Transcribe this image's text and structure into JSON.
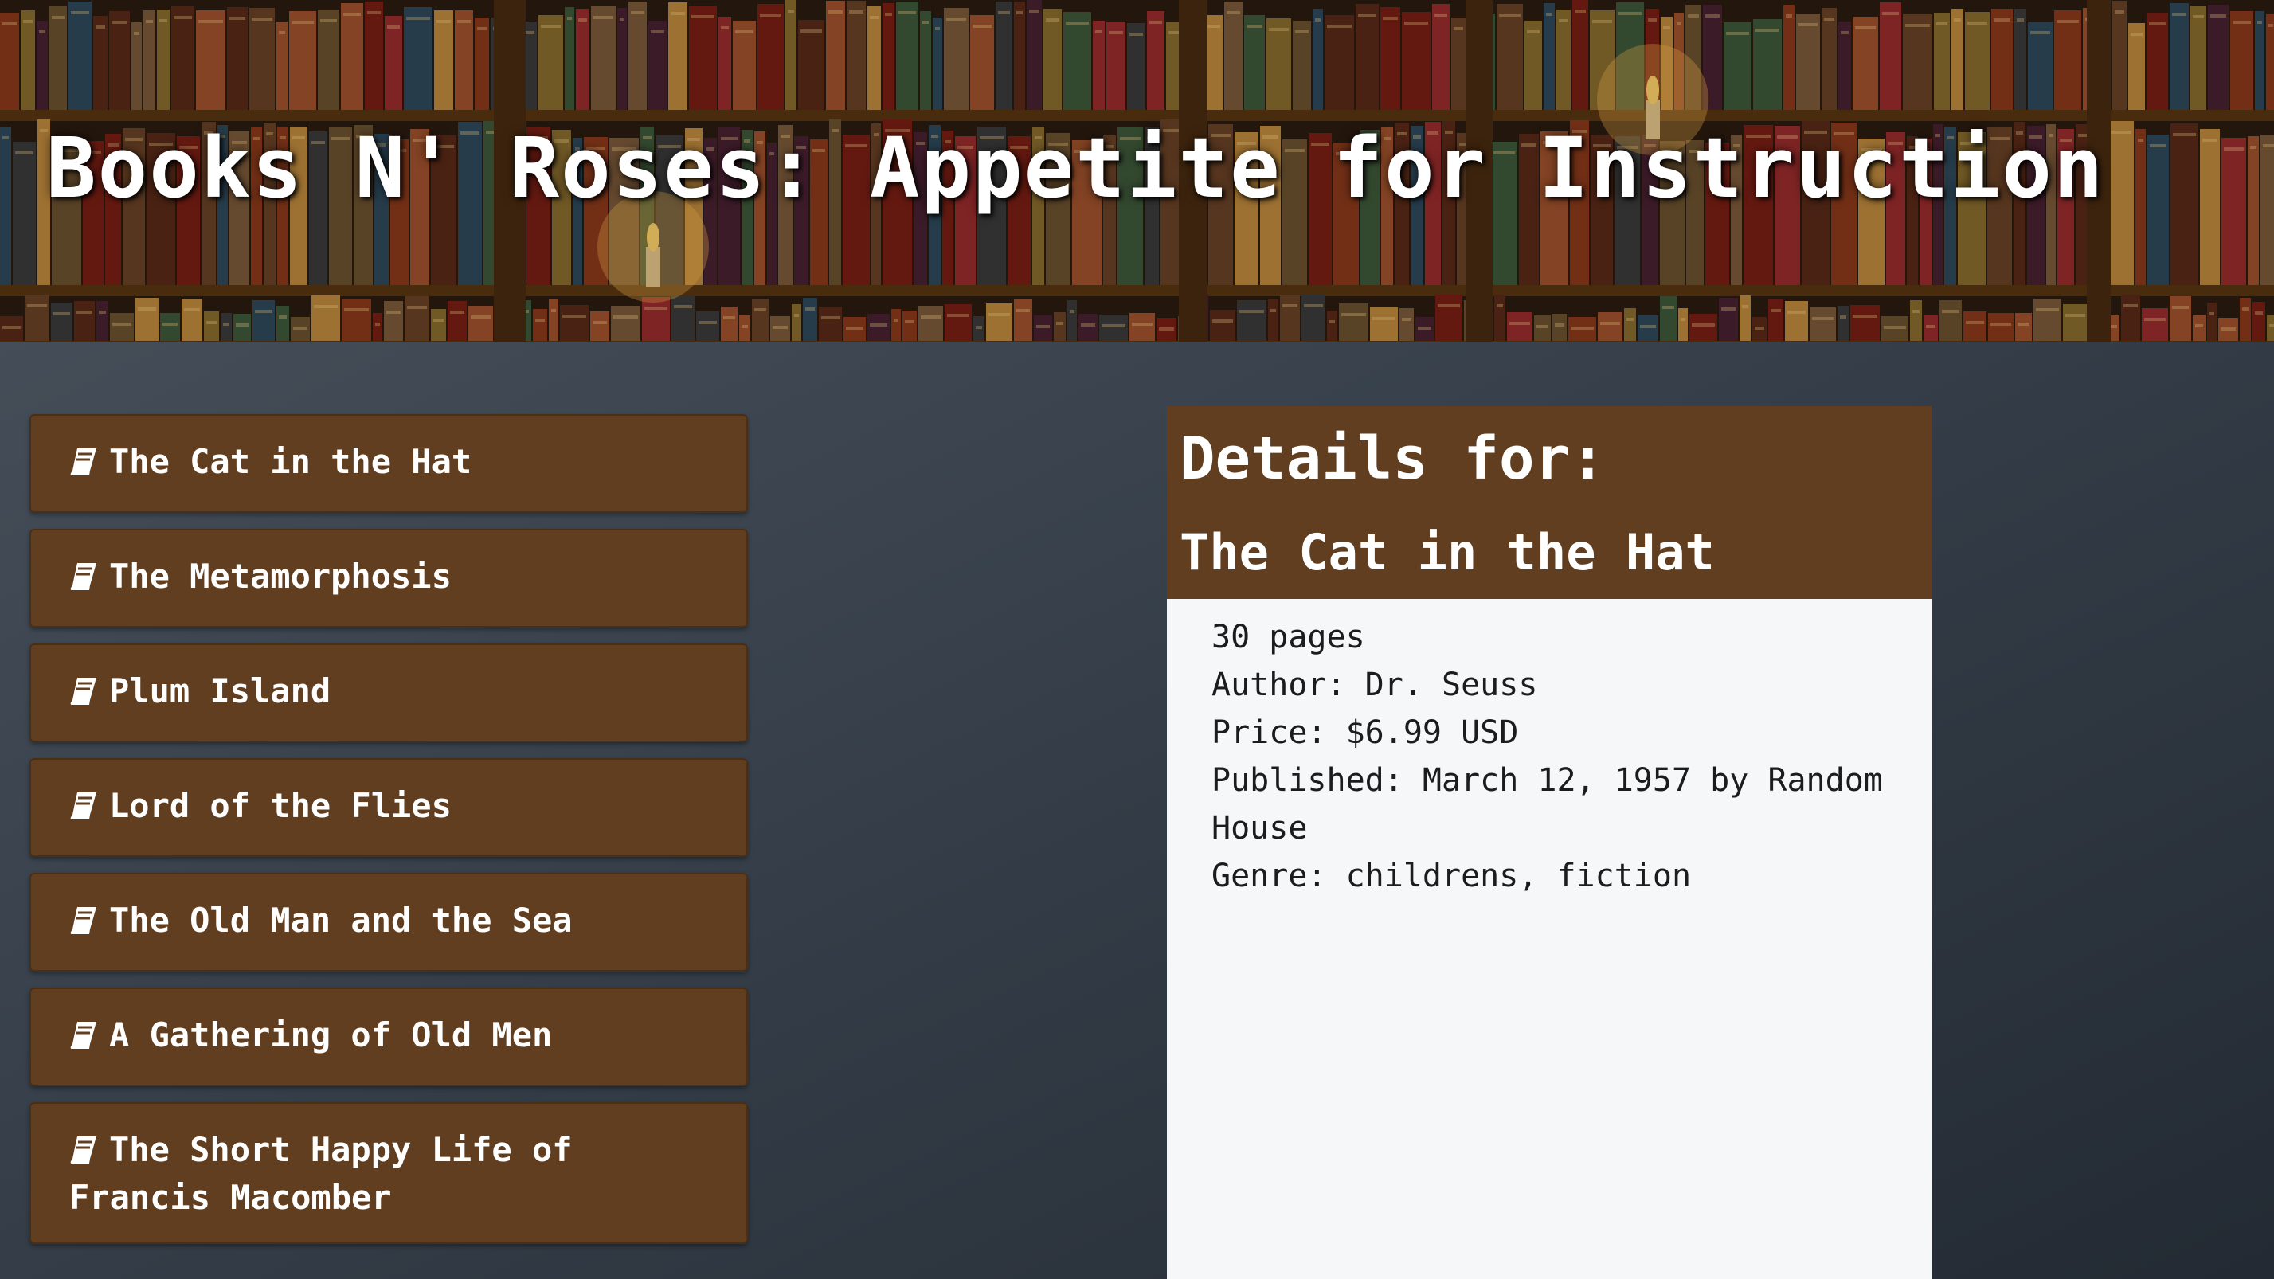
{
  "site": {
    "title": "Books N' Roses: Appetite for Instruction"
  },
  "book_list": [
    {
      "title": "The Cat in the Hat",
      "icon": "book-icon"
    },
    {
      "title": "The Metamorphosis",
      "icon": "book-icon"
    },
    {
      "title": "Plum Island",
      "icon": "book-icon"
    },
    {
      "title": "Lord of the Flies",
      "icon": "book-icon"
    },
    {
      "title": "The Old Man and the Sea",
      "icon": "book-icon"
    },
    {
      "title": "A Gathering of Old Men",
      "icon": "book-icon"
    },
    {
      "title": "The Short Happy Life of Francis Macomber",
      "icon": "book-icon"
    }
  ],
  "details": {
    "heading": "Details for:",
    "book_title": "The Cat in the Hat",
    "pages": "30 pages",
    "author": "Author: Dr. Seuss",
    "price": "Price: $6.99 USD",
    "published": "Published: March 12, 1957 by Random House",
    "genre": "Genre: childrens, fiction"
  },
  "colors": {
    "item_background": "#603e1f",
    "panel_background": "#f5f7f9",
    "page_background": "#38414c"
  }
}
